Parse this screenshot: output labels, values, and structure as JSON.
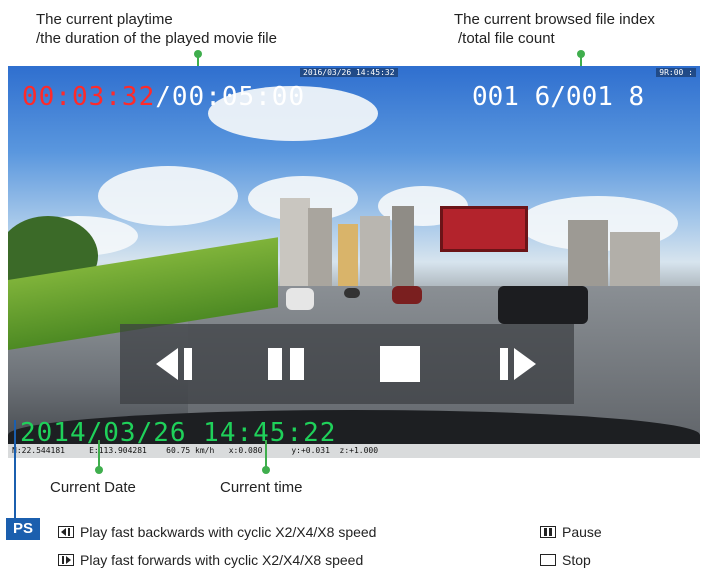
{
  "annotations": {
    "playtime_line1": "The current playtime",
    "playtime_line2": "/the duration of the played movie file",
    "index_line1": "The current browsed file index",
    "index_line2": "/total file count",
    "date_label": "Current Date",
    "time_label": "Current time"
  },
  "osd": {
    "current_playtime": "00:03:32",
    "duration": "/00:05:00",
    "file_index": "001 6/001 8",
    "datetime_stamp": "2014/03/26 14:45:22",
    "top_stamp": "2016/03/26  14:45:32",
    "corner_stamp": "9R:00 :",
    "gps_bar": "N:22.544181     E:113.904281    60.75 km/h   x:0.080      y:+0.031  z:+1.000"
  },
  "controls": [
    {
      "name": "rewind",
      "icon": "fast-backward-icon"
    },
    {
      "name": "pause",
      "icon": "pause-icon"
    },
    {
      "name": "stop",
      "icon": "stop-icon"
    },
    {
      "name": "forward",
      "icon": "fast-forward-icon"
    }
  ],
  "ps": {
    "badge": "PS",
    "rewind_desc": "Play fast backwards with cyclic X2/X4/X8 speed",
    "forward_desc": "Play fast forwards with cyclic X2/X4/X8 speed",
    "pause_desc": "Pause",
    "stop_desc": "Stop"
  },
  "colors": {
    "connector_green": "#3fae4d",
    "playtime_red": "#ff2a2a",
    "osd_green": "#1fd15a",
    "ps_blue": "#1b5fae"
  }
}
